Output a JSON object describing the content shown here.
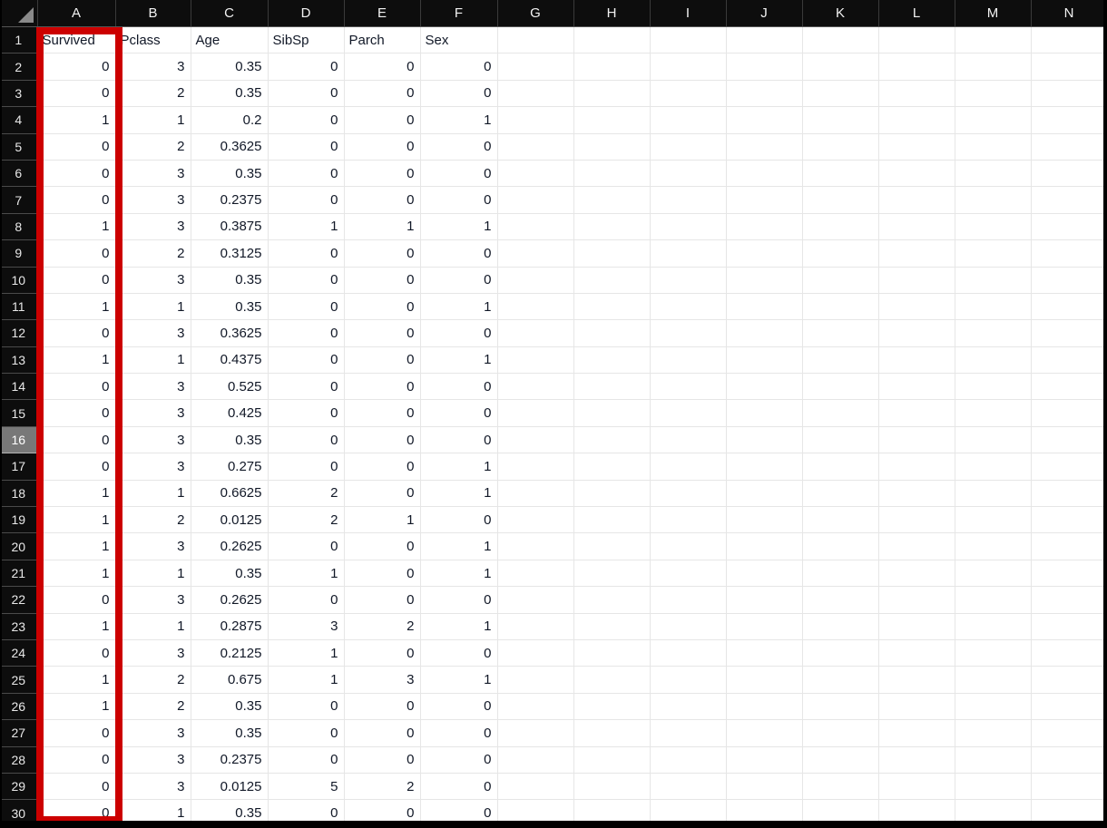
{
  "app": {
    "type": "spreadsheet",
    "select_all_icon": "select-all-triangle-icon"
  },
  "columns": {
    "headers": [
      "A",
      "B",
      "C",
      "D",
      "E",
      "F",
      "G",
      "H",
      "I",
      "J",
      "K",
      "L",
      "M",
      "N"
    ],
    "data_columns": 6,
    "empty_columns": [
      "G",
      "H",
      "I",
      "J",
      "K",
      "L",
      "M",
      "N"
    ]
  },
  "rows": {
    "numbers": [
      1,
      2,
      3,
      4,
      5,
      6,
      7,
      8,
      9,
      10,
      11,
      12,
      13,
      14,
      15,
      16,
      17,
      18,
      19,
      20,
      21,
      22,
      23,
      24,
      25,
      26,
      27,
      28,
      29,
      30
    ],
    "active_row": 16
  },
  "table": {
    "field_names": [
      "Survived",
      "Pclass",
      "Age",
      "SibSp",
      "Parch",
      "Sex"
    ],
    "values": [
      [
        "0",
        "3",
        "0.35",
        "0",
        "0",
        "0"
      ],
      [
        "0",
        "2",
        "0.35",
        "0",
        "0",
        "0"
      ],
      [
        "1",
        "1",
        "0.2",
        "0",
        "0",
        "1"
      ],
      [
        "0",
        "2",
        "0.3625",
        "0",
        "0",
        "0"
      ],
      [
        "0",
        "3",
        "0.35",
        "0",
        "0",
        "0"
      ],
      [
        "0",
        "3",
        "0.2375",
        "0",
        "0",
        "0"
      ],
      [
        "1",
        "3",
        "0.3875",
        "1",
        "1",
        "1"
      ],
      [
        "0",
        "2",
        "0.3125",
        "0",
        "0",
        "0"
      ],
      [
        "0",
        "3",
        "0.35",
        "0",
        "0",
        "0"
      ],
      [
        "1",
        "1",
        "0.35",
        "0",
        "0",
        "1"
      ],
      [
        "0",
        "3",
        "0.3625",
        "0",
        "0",
        "0"
      ],
      [
        "1",
        "1",
        "0.4375",
        "0",
        "0",
        "1"
      ],
      [
        "0",
        "3",
        "0.525",
        "0",
        "0",
        "0"
      ],
      [
        "0",
        "3",
        "0.425",
        "0",
        "0",
        "0"
      ],
      [
        "0",
        "3",
        "0.35",
        "0",
        "0",
        "0"
      ],
      [
        "0",
        "3",
        "0.275",
        "0",
        "0",
        "1"
      ],
      [
        "1",
        "1",
        "0.6625",
        "2",
        "0",
        "1"
      ],
      [
        "1",
        "2",
        "0.0125",
        "2",
        "1",
        "0"
      ],
      [
        "1",
        "3",
        "0.2625",
        "0",
        "0",
        "1"
      ],
      [
        "1",
        "1",
        "0.35",
        "1",
        "0",
        "1"
      ],
      [
        "0",
        "3",
        "0.2625",
        "0",
        "0",
        "0"
      ],
      [
        "1",
        "1",
        "0.2875",
        "3",
        "2",
        "1"
      ],
      [
        "0",
        "3",
        "0.2125",
        "1",
        "0",
        "0"
      ],
      [
        "1",
        "2",
        "0.675",
        "1",
        "3",
        "1"
      ],
      [
        "1",
        "2",
        "0.35",
        "0",
        "0",
        "0"
      ],
      [
        "0",
        "3",
        "0.35",
        "0",
        "0",
        "0"
      ],
      [
        "0",
        "3",
        "0.2375",
        "0",
        "0",
        "0"
      ],
      [
        "0",
        "3",
        "0.0125",
        "5",
        "2",
        "0"
      ],
      [
        "0",
        "1",
        "0.35",
        "0",
        "0",
        "0"
      ]
    ]
  },
  "annotation": {
    "type": "rectangle-highlight",
    "color": "#cc0000",
    "target_column": "A",
    "target_field": "Survived"
  },
  "colors": {
    "header_background": "#0d0d0d",
    "header_text": "#f2f2f2",
    "cell_background": "#ffffff",
    "cell_text": "#111827",
    "gridline": "#e6e6e6",
    "active_row_header": "#787878",
    "annotation": "#cc0000"
  }
}
